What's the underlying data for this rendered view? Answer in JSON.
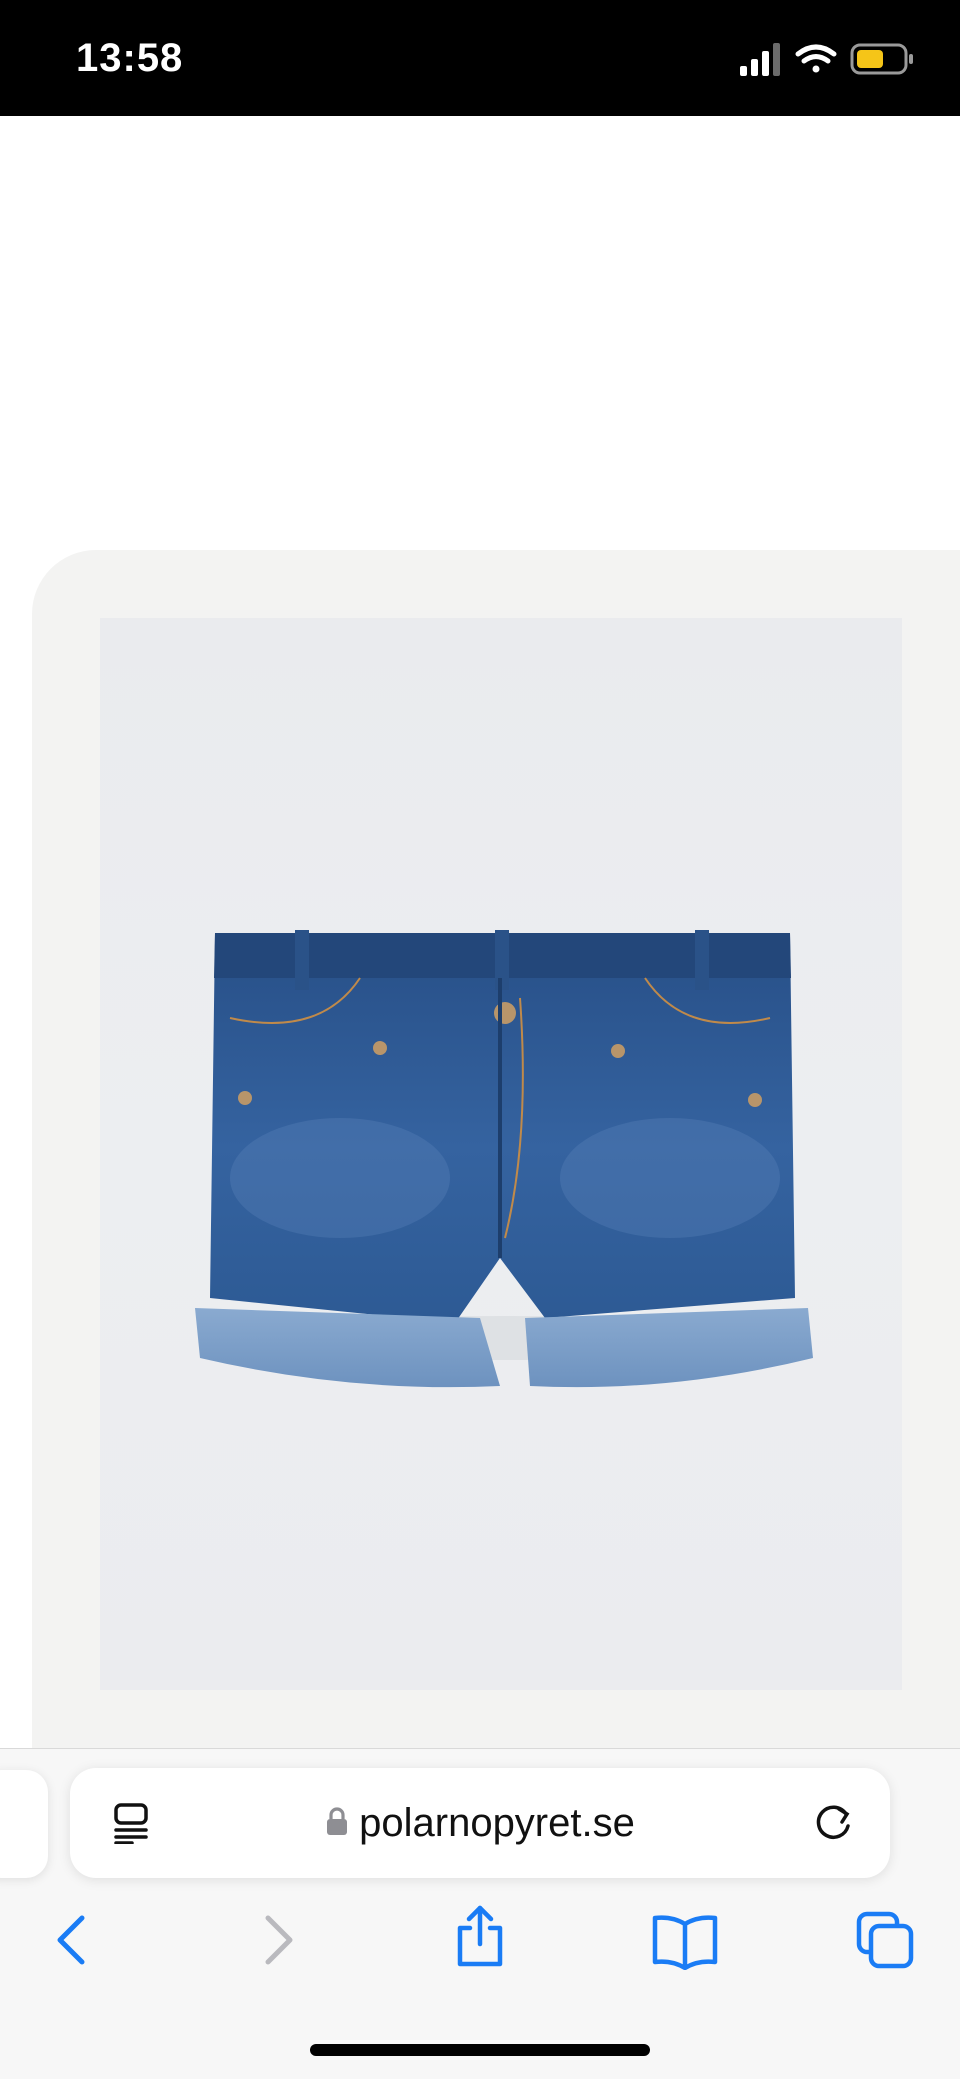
{
  "status_bar": {
    "time": "13:58",
    "signal_icon": "cellular-signal-icon",
    "wifi_icon": "wifi-icon",
    "battery_icon": "battery-icon"
  },
  "product": {
    "image_icon": "denim-shorts-image"
  },
  "address_bar": {
    "url": "polarnopyret.se",
    "reader_icon": "reader-mode-icon",
    "lock_icon": "lock-icon",
    "reload_icon": "reload-icon"
  },
  "toolbar": {
    "back_icon": "chevron-left-icon",
    "forward_icon": "chevron-right-icon",
    "share_icon": "share-icon",
    "bookmarks_icon": "book-icon",
    "tabs_icon": "tabs-icon"
  },
  "colors": {
    "accent": "#1a7cf5",
    "battery": "#f5c518",
    "disabled": "#b9b9be",
    "denim_dark": "#2f5c96",
    "denim_light": "#7d9fc8"
  }
}
